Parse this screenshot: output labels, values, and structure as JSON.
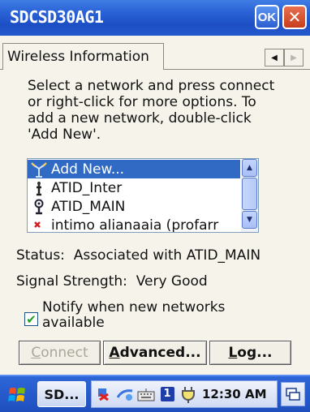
{
  "window": {
    "title": "SDCSD30AG1",
    "ok_label": "OK",
    "close_glyph": "✕"
  },
  "tabs": [
    {
      "label": "Wireless Information",
      "selected": true
    }
  ],
  "tab_scroll": {
    "left_glyph": "◀",
    "right_glyph": "▶"
  },
  "instructions": "Select a network and press connect\nor right-click for more options.  To\nadd a new network, double-click\n'Add New'.",
  "networks": {
    "items": [
      {
        "label": "Add New...",
        "icon": "antenna-icon",
        "selected": true
      },
      {
        "label": "ATID_Inter",
        "icon": "adhoc-antenna-icon",
        "selected": false
      },
      {
        "label": "ATID_MAIN",
        "icon": "connected-antenna-icon",
        "selected": false
      },
      {
        "label": "intimo alianaaia (profarr",
        "icon": "red-antenna-icon",
        "selected": false
      }
    ],
    "scroll_up_glyph": "▲",
    "scroll_down_glyph": "▼"
  },
  "status": {
    "label": "Status:",
    "value": "Associated with ATID_MAIN"
  },
  "signal": {
    "label": "Signal Strength:",
    "value": "Very Good"
  },
  "notify": {
    "label": "Notify when new networks available",
    "checked": true,
    "check_glyph": "✔"
  },
  "buttons": {
    "connect": "Connect",
    "connect_underline": "C",
    "connect_rest": "onnect",
    "advanced_underline": "A",
    "advanced_rest": "dvanced...",
    "log_underline": "L",
    "log_rest": "og..."
  },
  "taskbar": {
    "task": "SD...",
    "clock": "12:30 AM",
    "badge": "1"
  },
  "colors": {
    "titlebar": "#2a62d6",
    "selection": "#316ac5",
    "check": "#21a121"
  }
}
